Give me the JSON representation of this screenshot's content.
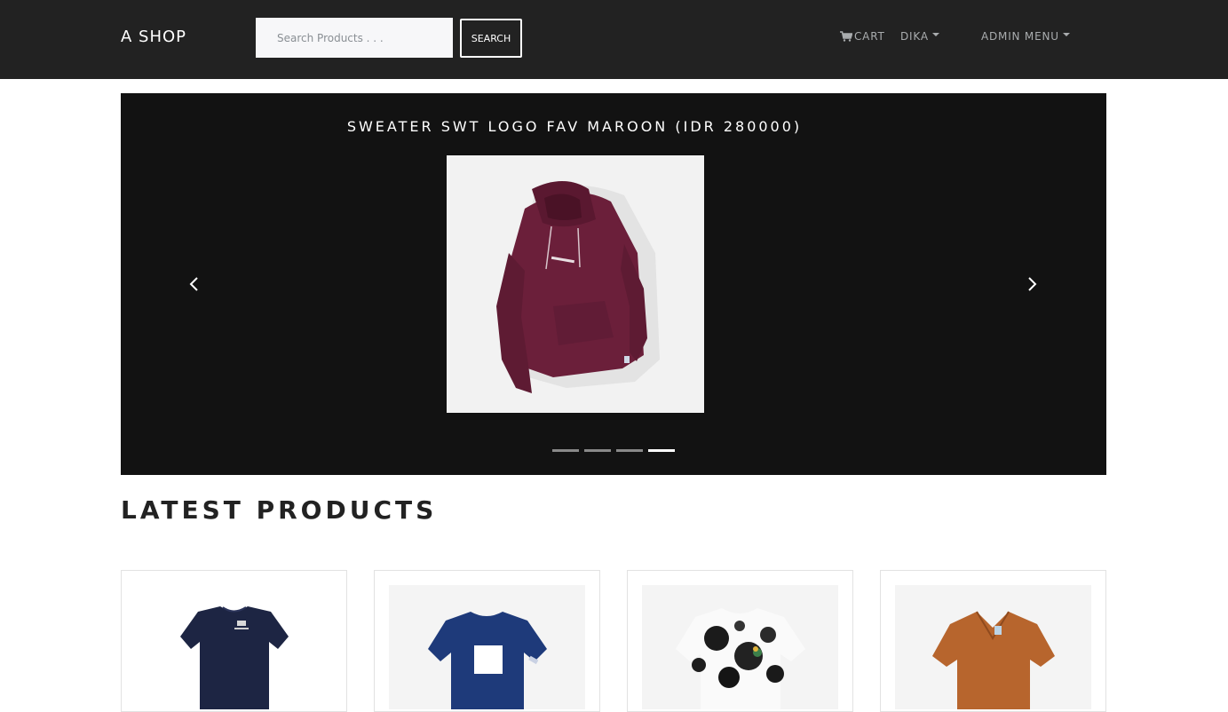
{
  "navbar": {
    "brand": "A SHOP",
    "search": {
      "placeholder": "Search Products . . .",
      "value": "",
      "button_label": "SEARCH"
    },
    "cart_label": "CART",
    "user_label": "DIKA",
    "admin_label": "ADMIN MENU",
    "icons": {
      "cart": "shopping-cart-icon",
      "dropdown": "caret-down-icon"
    }
  },
  "carousel": {
    "caption": "SWEATER SWT LOGO FAV MAROON (IDR 280000)",
    "image": "maroon-hoodie",
    "slide_count": 4,
    "active_slide": 4,
    "controls": {
      "prev": "chevron-left-icon",
      "next": "chevron-right-icon"
    }
  },
  "latest": {
    "title": "LATEST PRODUCTS",
    "products": [
      {
        "image": "navy-tshirt-small-logo"
      },
      {
        "image": "blue-tshirt-box-print"
      },
      {
        "image": "black-white-tie-dye-tshirt"
      },
      {
        "image": "brown-short-sleeve-shirt"
      }
    ]
  },
  "colors": {
    "navbar": "#222222",
    "carousel_bg": "#121212",
    "hoodie": "#6b1f3a",
    "accent_white": "#ffffff"
  }
}
